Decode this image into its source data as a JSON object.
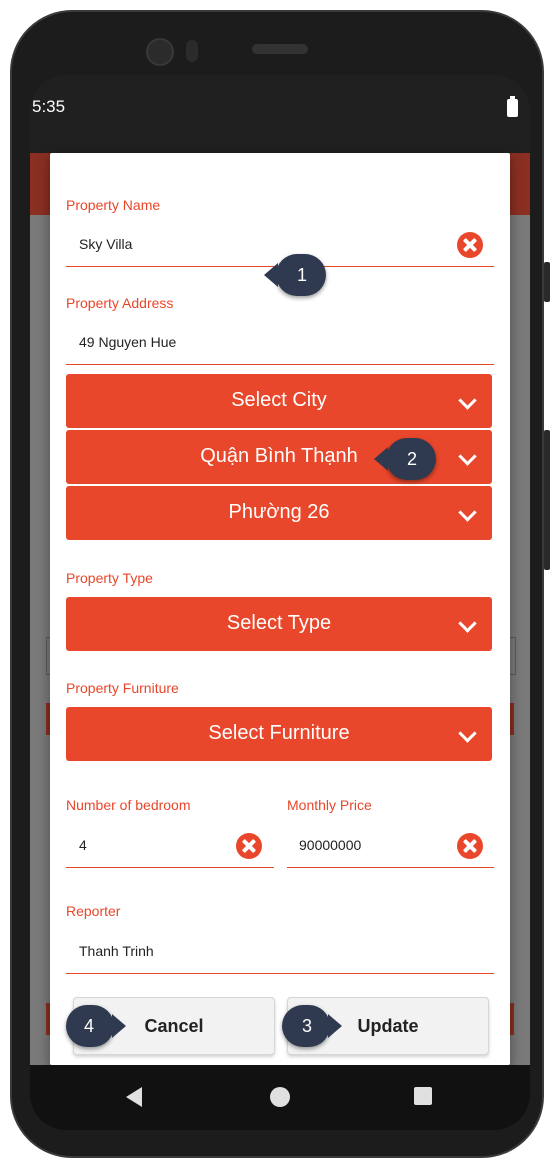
{
  "status_bar": {
    "time": "5:35"
  },
  "form": {
    "property_name": {
      "label": "Property Name",
      "value": "Sky Villa"
    },
    "property_address": {
      "label": "Property Address",
      "value": "49 Nguyen Hue"
    },
    "city_select": {
      "value": "Select City"
    },
    "district_select": {
      "value": "Quận Bình Thạnh"
    },
    "ward_select": {
      "value": "Phường 26"
    },
    "property_type": {
      "label": "Property Type",
      "value": "Select Type"
    },
    "property_furniture": {
      "label": "Property Furniture",
      "value": "Select Furniture"
    },
    "bedrooms": {
      "label": "Number of bedroom",
      "value": "4"
    },
    "monthly_price": {
      "label": "Monthly Price",
      "value": "90000000"
    },
    "reporter": {
      "label": "Reporter",
      "value": "Thanh Trinh"
    }
  },
  "buttons": {
    "cancel": "Cancel",
    "update": "Update"
  },
  "callouts": [
    "1",
    "2",
    "3",
    "4"
  ],
  "colors": {
    "accent": "#e8472b",
    "callout": "#2f3a50"
  }
}
